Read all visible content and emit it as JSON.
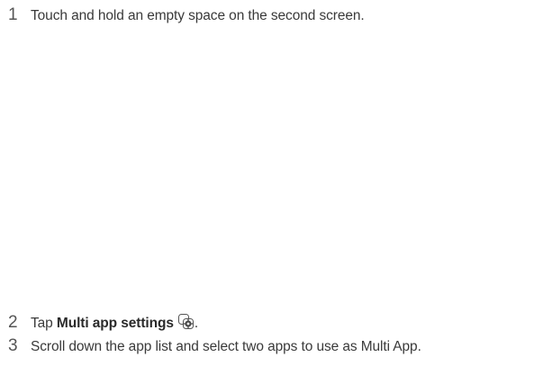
{
  "steps": [
    {
      "number": "1",
      "text": "Touch and hold an empty space on the second screen."
    },
    {
      "number": "2",
      "prefix": "Tap ",
      "bold": "Multi app settings",
      "suffix": ".",
      "icon": "multi-app-settings-icon"
    },
    {
      "number": "3",
      "text": "Scroll down the app list and select two apps to use as Multi App."
    }
  ]
}
